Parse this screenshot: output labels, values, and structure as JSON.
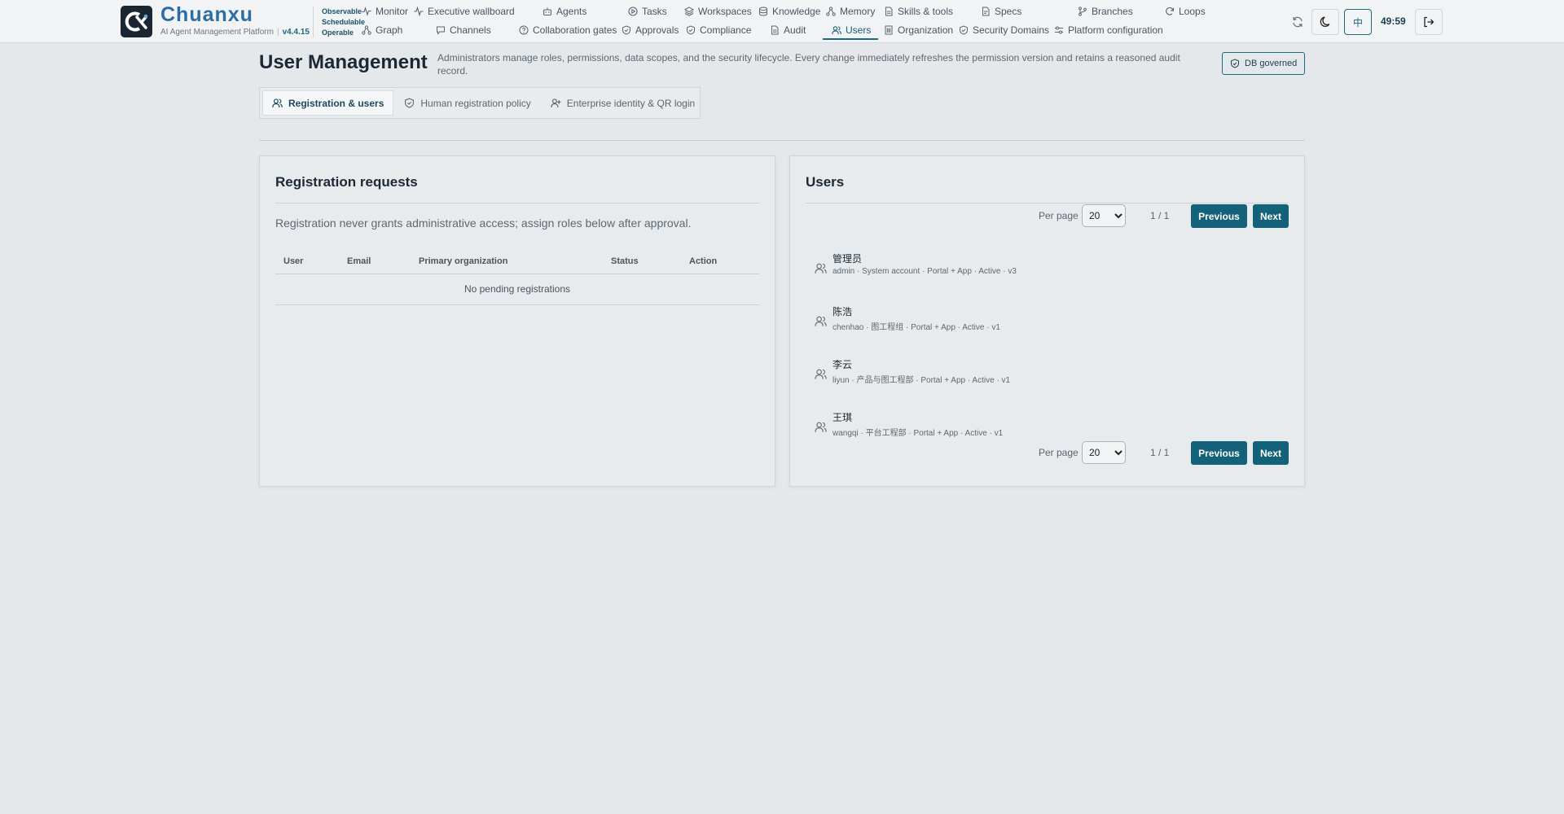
{
  "brand": {
    "name": "Chuanxu",
    "subtitle": "AI Agent Management Platform",
    "version": "v4.4.15",
    "motto": [
      "Observable",
      "Schedulable",
      "Operable"
    ]
  },
  "nav": {
    "row1": [
      {
        "label": "Monitor",
        "icon": "activity-icon"
      },
      {
        "label": "Executive wallboard",
        "icon": "pulse-icon"
      },
      {
        "label": "Agents",
        "icon": "robot-icon"
      },
      {
        "label": "Tasks",
        "icon": "play-circle-icon"
      },
      {
        "label": "Workspaces",
        "icon": "layers-icon"
      },
      {
        "label": "Knowledge",
        "icon": "database-icon"
      },
      {
        "label": "Memory",
        "icon": "nodes-icon"
      },
      {
        "label": "Skills & tools",
        "icon": "document-icon"
      },
      {
        "label": "Specs",
        "icon": "spec-document-icon"
      },
      {
        "label": "Branches",
        "icon": "git-branch-icon"
      },
      {
        "label": "Loops",
        "icon": "refresh-icon"
      }
    ],
    "row2": [
      {
        "label": "Graph",
        "icon": "graph-icon"
      },
      {
        "label": "Channels",
        "icon": "message-icon"
      },
      {
        "label": "Collaboration gates",
        "icon": "help-circle-icon"
      },
      {
        "label": "Approvals",
        "icon": "shield-check-icon"
      },
      {
        "label": "Compliance",
        "icon": "shield-check-icon"
      },
      {
        "label": "Audit",
        "icon": "audit-document-icon"
      },
      {
        "label": "Users",
        "icon": "users-icon"
      },
      {
        "label": "Organization",
        "icon": "building-icon"
      },
      {
        "label": "Security Domains",
        "icon": "shield-check-icon"
      },
      {
        "label": "Platform configuration",
        "icon": "sliders-icon"
      }
    ],
    "active": "Users"
  },
  "header_actions": {
    "language": "中",
    "session_timer": "49:59"
  },
  "page": {
    "title": "User Management",
    "description": "Administrators manage roles, permissions, data scopes, and the security lifecycle. Every change immediately refreshes the permission version and retains a reasoned audit record.",
    "badge": "DB governed"
  },
  "tabs": [
    {
      "label": "Registration & users",
      "icon": "users-icon",
      "active": true
    },
    {
      "label": "Human registration policy",
      "icon": "shield-check-icon",
      "active": false
    },
    {
      "label": "Enterprise identity & QR login",
      "icon": "user-plus-icon",
      "active": false
    }
  ],
  "registration": {
    "title": "Registration requests",
    "note": "Registration never grants administrative access; assign roles below after approval.",
    "columns": [
      "User",
      "Email",
      "Primary organization",
      "Status",
      "Action"
    ],
    "empty": "No pending registrations"
  },
  "users": {
    "title": "Users",
    "pager": {
      "per_page_label": "Per page",
      "per_page": "20",
      "per_page_options": [
        "20"
      ],
      "page": "1 / 1",
      "previous": "Previous",
      "next": "Next"
    },
    "list": [
      {
        "name": "管理员",
        "meta": "admin · System account · Portal + App · Active · v3"
      },
      {
        "name": "陈浩",
        "meta": "chenhao · 图工程组 · Portal + App · Active · v1"
      },
      {
        "name": "李云",
        "meta": "liyun · 产品与图工程部 · Portal + App · Active · v1"
      },
      {
        "name": "王琪",
        "meta": "wangqi · 平台工程部 · Portal + App · Active · v1"
      }
    ]
  }
}
